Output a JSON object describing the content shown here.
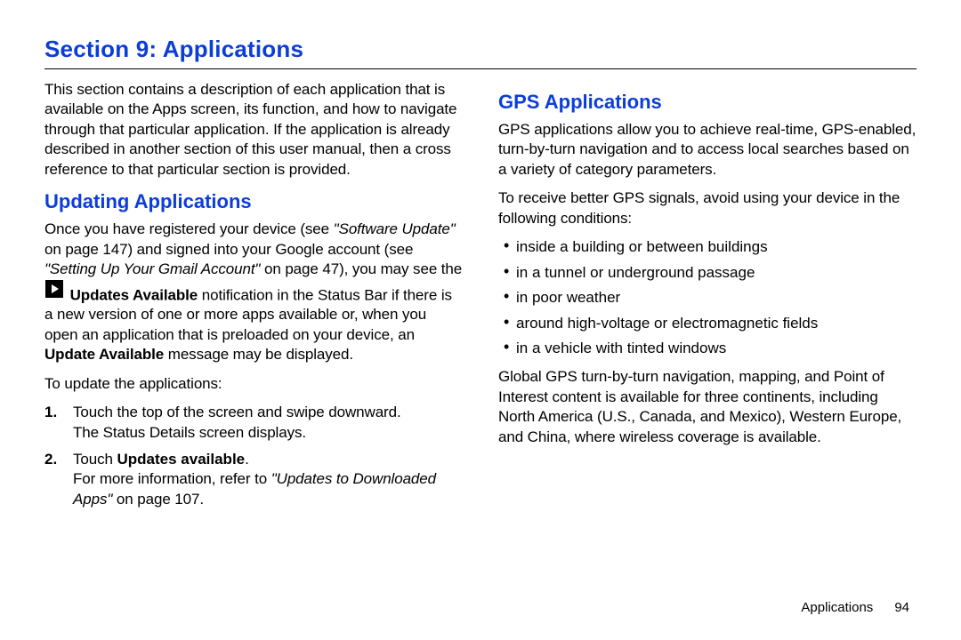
{
  "title": "Section 9: Applications",
  "left": {
    "intro": "This section contains a description of each application that is available on the Apps screen, its function, and how to navigate through that particular application. If the application is already described in another section of this user manual, then a cross reference to that particular section is provided.",
    "subhead": "Updating Applications",
    "p1_a": "Once you have registered your device (see ",
    "p1_ref1": "\"Software Update\"",
    "p1_b": " on page 147) and signed into your Google account (see ",
    "p1_ref2": "\"Setting Up Your Gmail Account\"",
    "p1_c": " on page 47), you may see the ",
    "p1_bold1": "Updates Available",
    "p1_d": " notification in the Status Bar if there is a new version of one or more apps available or, when you open an application that is preloaded on your device, an ",
    "p1_bold2": "Update Available",
    "p1_e": " message may be displayed.",
    "p2": "To update the applications:",
    "step1_a": "Touch the top of the screen and swipe downward.",
    "step1_b": "The Status Details screen displays.",
    "step2_a": "Touch ",
    "step2_bold": "Updates available",
    "step2_b": ".",
    "step2_c": "For more information, refer to ",
    "step2_ref": "\"Updates to Downloaded Apps\"",
    "step2_d": " on page 107."
  },
  "right": {
    "subhead": "GPS Applications",
    "p1": "GPS applications allow you to achieve real-time, GPS-enabled, turn-by-turn navigation and to access local searches based on a variety of category parameters.",
    "p2": "To receive better GPS signals, avoid using your device in the following conditions:",
    "b1": "inside a building or between buildings",
    "b2": "in a tunnel or underground passage",
    "b3": "in poor weather",
    "b4": "around high-voltage or electromagnetic fields",
    "b5": "in a vehicle with tinted windows",
    "p3": "Global GPS turn-by-turn navigation, mapping, and Point of Interest content is available for three continents, including North America (U.S., Canada, and Mexico), Western Europe, and China, where wireless coverage is available."
  },
  "footer": {
    "section": "Applications",
    "page": "94"
  }
}
